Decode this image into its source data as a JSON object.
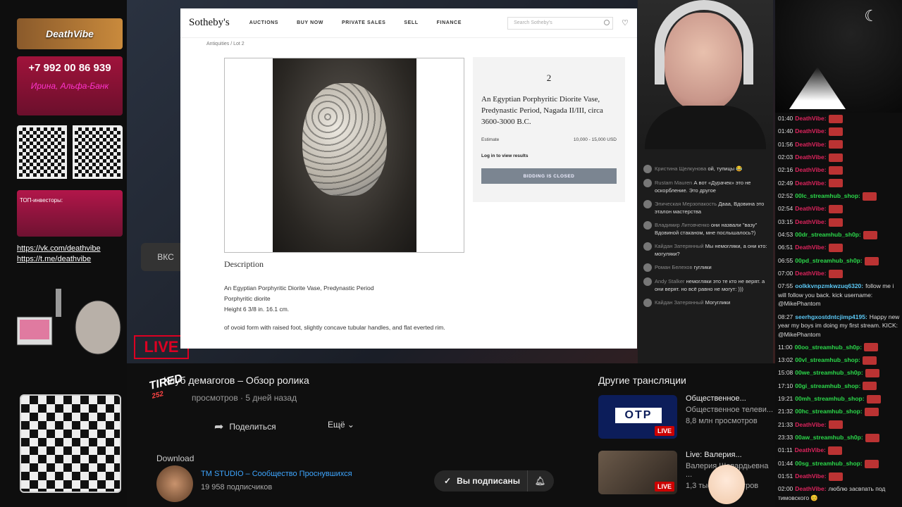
{
  "left_panel": {
    "brand": "DeathVibe",
    "phone": "+7 992 00 86 939",
    "bank": "Ирина, Альфа-Банк",
    "invest_label": "ТОП-инвесторы:",
    "links": [
      "https://vk.com/deathvibe",
      "https://t.me/deathvibe"
    ]
  },
  "stream": {
    "vk_label": "ВКС",
    "live_label": "LIVE"
  },
  "browser": {
    "logo": "Sotheby's",
    "menu": [
      "AUCTIONS",
      "BUY NOW",
      "PRIVATE SALES",
      "SELL",
      "FINANCE"
    ],
    "search_placeholder": "Search Sotheby's",
    "breadcrumb": "Antiquities  /  Lot 2",
    "lot": {
      "number": "2",
      "title": "An Egyptian Porphyritic Diorite Vase, Predynastic Period, Nagada II/III, circa 3600-3000 B.C.",
      "estimate_label": "Estimate",
      "estimate_value": "10,000 - 15,000 USD",
      "login_text": "Log in to view results",
      "closed_label": "BIDDING IS CLOSED"
    },
    "description_heading": "Description",
    "description_lines": [
      "An Egyptian Porphyritic Diorite Vase, Predynastic Period",
      "Porphyritic diorite",
      "Height 6 3/8 in. 16.1 cm."
    ],
    "description_rim": "of ovoid form with raised foot, slightly concave tubular handles, and flat everted rim."
  },
  "stream_chat": [
    {
      "user": "Кристина Щелкунова",
      "text": "ой, тупицы 😂"
    },
    {
      "user": "Rustam Mauren",
      "text": "А вот «Дурачек» это не оскорбление. Это другое"
    },
    {
      "user": "Эпическая Мерзопакость",
      "text": "Дааа, Вдовина это эталон мастерства"
    },
    {
      "user": "Владимир Литовченко",
      "text": "они назвали \"вазу\" Вдовиной стаканом, мне послышалось?)"
    },
    {
      "user": "Кайдан Затерянный",
      "text": "Мы немогляки, а они кто: могуляки?"
    },
    {
      "user": "Роман Белехов",
      "text": "гуглики"
    },
    {
      "user": "Andy Stalker",
      "text": "немогляки это те кто не верят. а они верят. но всё равно не могут: )))"
    },
    {
      "user": "Кайдан Затерянный",
      "text": "Могуглики"
    }
  ],
  "twitch_chat": [
    {
      "time": "01:40",
      "user": "DeathVibe:",
      "color": "#e0245e",
      "text": ""
    },
    {
      "time": "01:40",
      "user": "DeathVibe:",
      "color": "#e0245e",
      "text": ""
    },
    {
      "time": "01:56",
      "user": "DeathVibe:",
      "color": "#e0245e",
      "text": ""
    },
    {
      "time": "02:03",
      "user": "DeathVibe:",
      "color": "#e0245e",
      "text": ""
    },
    {
      "time": "02:16",
      "user": "DeathVibe:",
      "color": "#e0245e",
      "text": ""
    },
    {
      "time": "02:49",
      "user": "DeathVibe:",
      "color": "#e0245e",
      "text": ""
    },
    {
      "time": "02:52",
      "user": "00lc_streamhub_shop:",
      "color": "#2bd84a",
      "text": ""
    },
    {
      "time": "02:54",
      "user": "DeathVibe:",
      "color": "#e0245e",
      "text": ""
    },
    {
      "time": "03:15",
      "user": "DeathVibe:",
      "color": "#e0245e",
      "text": ""
    },
    {
      "time": "04:53",
      "user": "00dr_streamhub_sh0p:",
      "color": "#2bd84a",
      "text": ""
    },
    {
      "time": "06:51",
      "user": "DeathVibe:",
      "color": "#e0245e",
      "text": ""
    },
    {
      "time": "06:55",
      "user": "00pd_streamhub_sh0p:",
      "color": "#2bd84a",
      "text": ""
    },
    {
      "time": "07:00",
      "user": "DeathVibe:",
      "color": "#e0245e",
      "text": ""
    },
    {
      "time": "07:55",
      "user": "oolkkvnpzmkwzuq6320:",
      "color": "#5bc8f5",
      "text": "follow me i will follow you back. kick username: @MikePhantom"
    },
    {
      "time": "08:27",
      "user": "seerhgxostdntcjimp4195:",
      "color": "#5bc8f5",
      "text": "Happy new year my boys im doing my first stream. KICK: @MikePhantom"
    },
    {
      "time": "11:00",
      "user": "00oo_streamhub_sh0p:",
      "color": "#2bd84a",
      "text": ""
    },
    {
      "time": "13:02",
      "user": "00vl_streamhub_shop:",
      "color": "#2bd84a",
      "text": ""
    },
    {
      "time": "15:08",
      "user": "00we_streamhub_sh0p:",
      "color": "#2bd84a",
      "text": ""
    },
    {
      "time": "17:10",
      "user": "00gi_streamhub_shop:",
      "color": "#2bd84a",
      "text": ""
    },
    {
      "time": "19:21",
      "user": "00mh_streamhub_shop:",
      "color": "#2bd84a",
      "text": ""
    },
    {
      "time": "21:32",
      "user": "00hc_streamhub_shop:",
      "color": "#2bd84a",
      "text": ""
    },
    {
      "time": "21:33",
      "user": "DeathVibe:",
      "color": "#e0245e",
      "text": ""
    },
    {
      "time": "23:33",
      "user": "00aw_streamhub_sh0p:",
      "color": "#2bd84a",
      "text": ""
    },
    {
      "time": "01:11",
      "user": "DeathVibe:",
      "color": "#e0245e",
      "text": ""
    },
    {
      "time": "01:44",
      "user": "00sg_streamhub_shop:",
      "color": "#2bd84a",
      "text": ""
    },
    {
      "time": "01:51",
      "user": "DeathVibe:",
      "color": "#e0245e",
      "text": ""
    },
    {
      "time": "02:00",
      "user": "DeathVibe:",
      "color": "#e0245e",
      "text": "люблю засвпать под тимовского 😊"
    }
  ],
  "youtube": {
    "title": "Клуб демагогов – Обзор ролика",
    "meta": "просмотров  ·  5 дней назад",
    "share": "Поделиться",
    "more": "Ещё",
    "download": "Download",
    "channel": "TM STUDIO – Сообщество Проснувшихся",
    "subscribers": "19 958 подписчиков",
    "subscribed": "Вы подписаны",
    "other_heading": "Другие трансляции",
    "recommended": [
      {
        "title": "Общественное...",
        "subtitle": "Общественное телеви...",
        "views": "8,8 млн просмотров",
        "badge": "LIVE",
        "thumb_text": "OTP"
      },
      {
        "title": "Live: Валерия...",
        "subtitle": "Валерия Шевардьевна ...",
        "views": "1,3 тыс. просмотров",
        "badge": "LIVE"
      }
    ]
  },
  "overlay": {
    "tired": "TIRED",
    "tired_num": "252"
  }
}
